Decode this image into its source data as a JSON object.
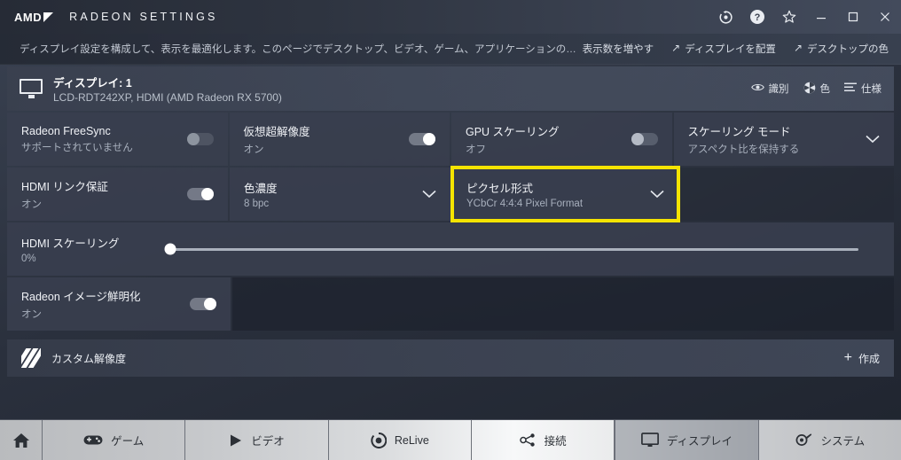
{
  "titlebar": {
    "brand": "AMD",
    "app_title": "RADEON SETTINGS",
    "buttons": [
      {
        "name": "update-icon",
        "label": "更新"
      },
      {
        "name": "help-icon",
        "label": "ヘルプ"
      },
      {
        "name": "star-icon",
        "label": "お気に入り"
      },
      {
        "name": "minimize-icon",
        "label": "最小化"
      },
      {
        "name": "maximize-icon",
        "label": "最大化"
      },
      {
        "name": "close-icon",
        "label": "閉じる"
      }
    ]
  },
  "description": {
    "text": "ディスプレイ設定を構成して、表示を最適化します。このページでデスクトップ、ビデオ、ゲーム、アプリケーションの画面表示を調整します。...",
    "links": [
      {
        "label": "表示数を増やす",
        "arrow": false
      },
      {
        "label": "ディスプレイを配置",
        "arrow": true
      },
      {
        "label": "デスクトップの色",
        "arrow": true
      }
    ]
  },
  "display_header": {
    "name": "ディスプレイ: 1",
    "sub": "LCD-RDT242XP, HDMI (AMD Radeon RX 5700)",
    "actions": [
      {
        "label": "識別",
        "icon": "eye-icon"
      },
      {
        "label": "色",
        "icon": "color-wheel-icon"
      },
      {
        "label": "仕様",
        "icon": "list-icon"
      }
    ]
  },
  "tiles": {
    "freesync": {
      "title": "Radeon FreeSync",
      "value": "サポートされていません",
      "state": "disabled"
    },
    "vsr": {
      "title": "仮想超解像度",
      "value": "オン",
      "state": "on"
    },
    "gpu_scaling": {
      "title": "GPU スケーリング",
      "value": "オフ",
      "state": "off"
    },
    "scaling_mode": {
      "title": "スケーリング モード",
      "value": "アスペクト比を保持する"
    },
    "hdmi_link": {
      "title": "HDMI リンク保証",
      "value": "オン",
      "state": "on"
    },
    "color_depth": {
      "title": "色濃度",
      "value": "8 bpc"
    },
    "pixel_format": {
      "title": "ピクセル形式",
      "value": "YCbCr 4:4:4 Pixel Format",
      "highlight_color": "#f5e400"
    },
    "hdmi_scaling": {
      "title": "HDMI スケーリング",
      "value": "0%",
      "percent": 0
    },
    "image_sharpen": {
      "title": "Radeon イメージ鮮明化",
      "value": "オン",
      "state": "on"
    }
  },
  "custom_resolution": {
    "label": "カスタム解像度",
    "action_label": "作成",
    "action_plus": "+"
  },
  "bottom_nav": [
    {
      "label": "",
      "icon": "home-icon",
      "active": false
    },
    {
      "label": "ゲーム",
      "icon": "gamepad-icon",
      "active": false
    },
    {
      "label": "ビデオ",
      "icon": "play-icon",
      "active": false
    },
    {
      "label": "ReLive",
      "icon": "relive-icon",
      "active": false
    },
    {
      "label": "接続",
      "icon": "nodes-icon",
      "active": false
    },
    {
      "label": "ディスプレイ",
      "icon": "monitor-icon",
      "active": true
    },
    {
      "label": "システム",
      "icon": "gear-wrench-icon",
      "active": false
    }
  ]
}
